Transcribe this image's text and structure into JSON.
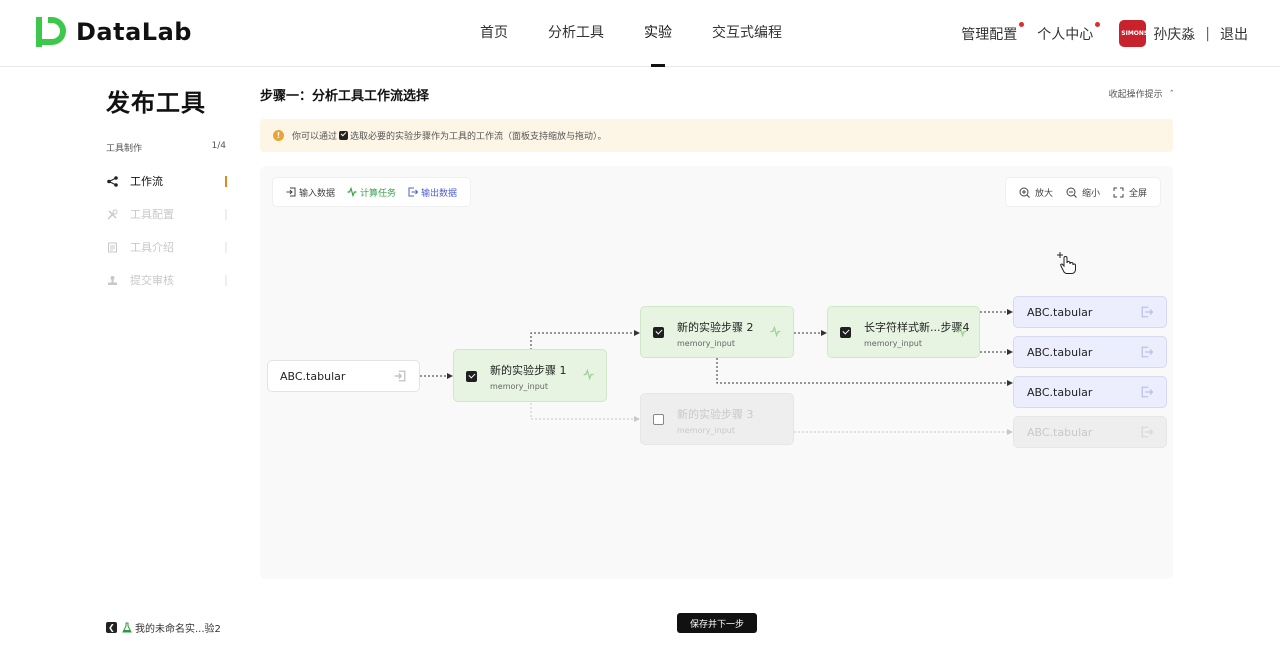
{
  "header": {
    "brand": "DataLab",
    "nav": [
      "首页",
      "分析工具",
      "实验",
      "交互式编程"
    ],
    "admin": "管理配置",
    "personal": "个人中心",
    "username": "孙庆淼",
    "separator": "|",
    "logout": "退出",
    "colors": {
      "brand": "#3cc84a",
      "dot": "#d9302c"
    }
  },
  "sidebar": {
    "title": "发布工具",
    "section": "工具制作",
    "progress": "1/4",
    "items": [
      {
        "label": "工作流",
        "icon": "workflow-icon",
        "state": "active"
      },
      {
        "label": "工具配置",
        "icon": "tools-icon",
        "state": "disabled"
      },
      {
        "label": "工具介绍",
        "icon": "document-icon",
        "state": "disabled"
      },
      {
        "label": "提交审核",
        "icon": "stamp-icon",
        "state": "disabled"
      }
    ],
    "footer": "我的未命名实...验2"
  },
  "main": {
    "step_title": "步骤一：分析工具工作流选择",
    "collapse": "收起操作提示",
    "tip_before": "你可以通过",
    "tip_after": "选取必要的实验步骤作为工具的工作流（面板支持缩放与拖动）。",
    "legend": {
      "input": "输入数据",
      "task": "计算任务",
      "output": "输出数据"
    },
    "zoom": {
      "in": "放大",
      "out": "缩小",
      "full": "全屏"
    },
    "nodes": {
      "input": "ABC.tabular",
      "step1": {
        "name": "新的实验步骤 1",
        "sub": "memory_input"
      },
      "step2": {
        "name": "新的实验步骤 2",
        "sub": "memory_input"
      },
      "step3": {
        "name": "新的实验步骤 3",
        "sub": "memory_input"
      },
      "step4": {
        "name": "长字符样式新...步骤4",
        "sub": "memory_input"
      },
      "out1": "ABC.tabular",
      "out2": "ABC.tabular",
      "out3": "ABC.tabular",
      "out4": "ABC.tabular"
    },
    "save": "保存并下一步"
  }
}
